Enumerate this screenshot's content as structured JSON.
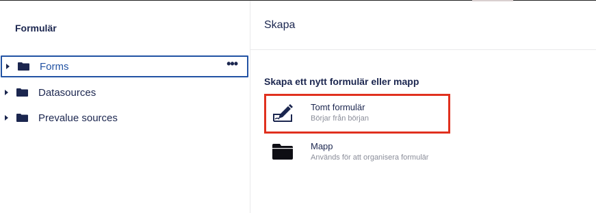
{
  "sidebar": {
    "title": "Formulär",
    "items": [
      {
        "label": "Forms",
        "selected": true,
        "more": "•••"
      },
      {
        "label": "Datasources",
        "selected": false
      },
      {
        "label": "Prevalue sources",
        "selected": false
      }
    ]
  },
  "main": {
    "title": "Skapa",
    "section_heading": "Skapa ett nytt formulär eller mapp",
    "options": [
      {
        "title": "Tomt formulär",
        "description": "Börjar från början",
        "icon": "edit-form-icon",
        "highlighted": true
      },
      {
        "title": "Mapp",
        "description": "Används för att organisera formulär",
        "icon": "folder-icon",
        "highlighted": false
      }
    ]
  },
  "colors": {
    "text": "#1b264f",
    "selected_border": "#2152a3",
    "highlight_border": "#e0301e",
    "muted_text": "#8a8d99",
    "divider": "#e9e9eb"
  }
}
